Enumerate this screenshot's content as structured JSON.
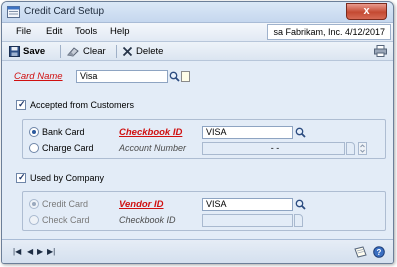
{
  "window": {
    "title": "Credit Card Setup",
    "close_glyph": "x"
  },
  "menu": {
    "items": [
      "File",
      "Edit",
      "Tools",
      "Help"
    ],
    "company": "sa  Fabrikam, Inc.  4/12/2017"
  },
  "toolbar": {
    "save_label": "Save",
    "clear_label": "Clear",
    "delete_label": "Delete"
  },
  "form": {
    "card_name_label": "Card Name",
    "card_name_value": "Visa",
    "accepted_label": "Accepted from Customers",
    "accepted_checked": true,
    "bank_card_label": "Bank Card",
    "charge_card_label": "Charge Card",
    "checkbook_id_label": "Checkbook ID",
    "checkbook_id_value": "VISA",
    "account_number_label": "Account Number",
    "account_number_value": "-       -",
    "used_label": "Used by Company",
    "used_checked": true,
    "credit_card_label": "Credit Card",
    "check_card_label": "Check Card",
    "vendor_id_label": "Vendor ID",
    "vendor_id_value": "VISA",
    "checkbook_id2_label": "Checkbook ID"
  },
  "colors": {
    "required_label": "#d01010",
    "window_bg": "#e3ecf7",
    "close_button": "#c44a32"
  },
  "icons": [
    "app-icon",
    "save-icon",
    "clear-icon",
    "delete-icon",
    "print-icon",
    "lookup-icon",
    "note-icon",
    "first-record-icon",
    "previous-record-icon",
    "next-record-icon",
    "last-record-icon",
    "help-icon"
  ]
}
